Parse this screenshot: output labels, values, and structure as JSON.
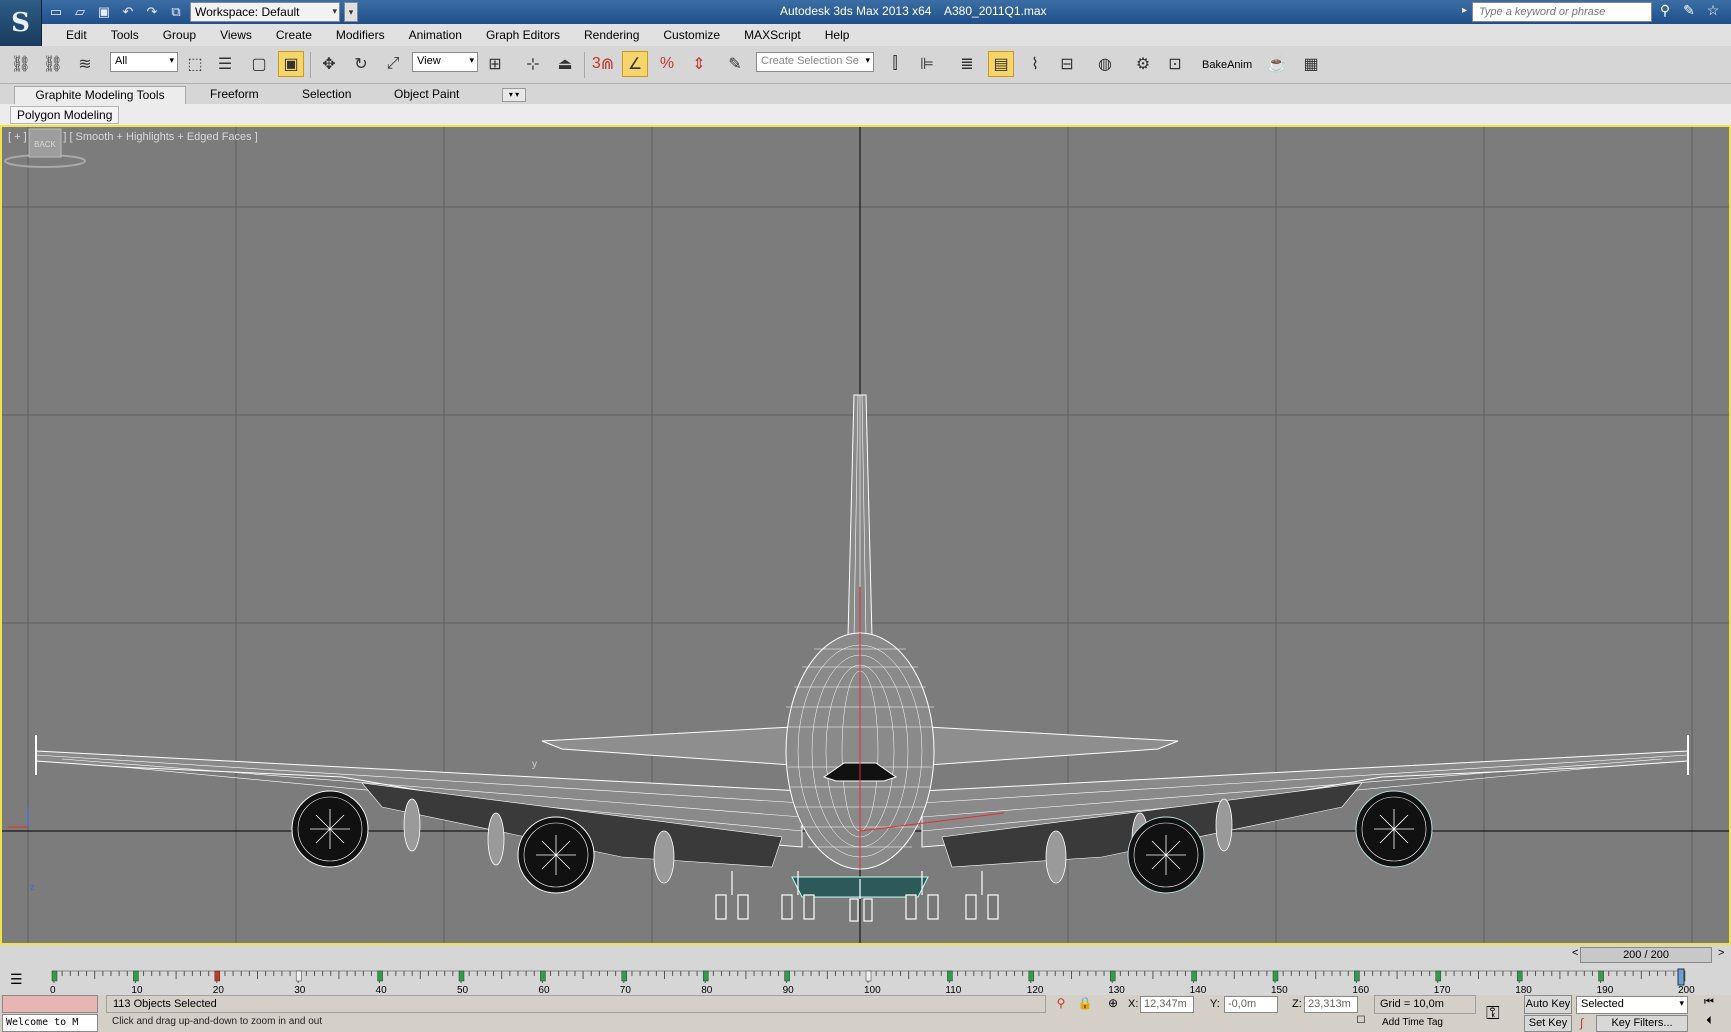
{
  "title_bar": {
    "logo": "S",
    "workspace": "Workspace: Default",
    "app_title": "Autodesk 3ds Max  2013 x64",
    "file_name": "A380_2011Q1.max",
    "search_placeholder": "Type a keyword or phrase",
    "quick_access_icons": [
      "new-icon",
      "open-icon",
      "save-icon",
      "undo-icon",
      "redo-icon",
      "project-icon"
    ],
    "right_icons": [
      "binoculars-icon",
      "tools-icon",
      "star-icon"
    ]
  },
  "menu": [
    "Edit",
    "Tools",
    "Group",
    "Views",
    "Create",
    "Modifiers",
    "Animation",
    "Graph Editors",
    "Rendering",
    "Customize",
    "MAXScript",
    "Help"
  ],
  "toolbar": {
    "filter": "All",
    "ref_coord": "View",
    "selection_set": "Create Selection Se",
    "bake_anim": "BakeAnim",
    "snap_label": "3"
  },
  "ribbon": {
    "tabs": [
      "Graphite Modeling Tools",
      "Freeform",
      "Selection",
      "Object Paint"
    ],
    "panel": "Polygon Modeling"
  },
  "viewport": {
    "label": "[ + ] [ Back ] [ Smooth + Highlights + Edged Faces ]",
    "viewcube": "BACK",
    "axis_y": "y",
    "axis_z": "z"
  },
  "time_slider": {
    "frame": "200 / 200",
    "prev": "<",
    "next": ">"
  },
  "trackbar": {
    "ticks": [
      "0",
      "10",
      "20",
      "30",
      "40",
      "50",
      "60",
      "70",
      "80",
      "90",
      "100",
      "110",
      "120",
      "130",
      "140",
      "150",
      "160",
      "170",
      "180",
      "190",
      "200"
    ]
  },
  "status": {
    "listener_text": "Welcome to M",
    "selection": "113 Objects Selected",
    "prompt": "Click and drag up-and-down to zoom in and out",
    "x_label": "X:",
    "x_value": "12,347m",
    "y_label": "Y:",
    "y_value": "-0,0m",
    "z_label": "Z:",
    "z_value": "23,313m",
    "grid": "Grid = 10,0m",
    "add_time_tag": "Add Time Tag",
    "auto_key": "Auto Key",
    "set_key": "Set Key",
    "key_mode": "Selected",
    "key_filters": "Key Filters..."
  },
  "colors": {
    "viewport_bg": "#7c7c7c",
    "viewport_border": "#f2e24a",
    "wireframe": "#ffffff",
    "title_bar": "#2a5b95"
  }
}
